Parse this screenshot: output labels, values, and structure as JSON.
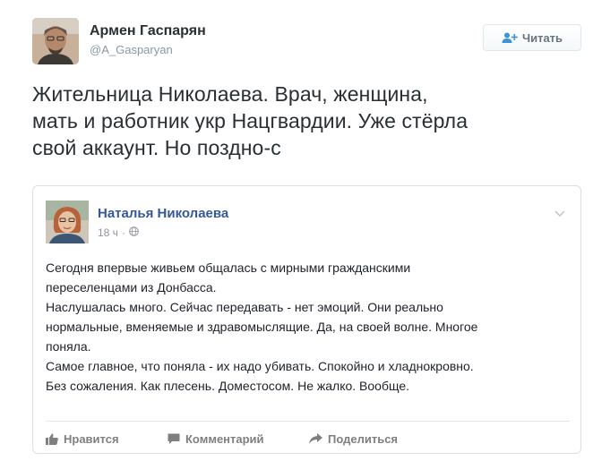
{
  "tweet": {
    "author": {
      "name": "Армен Гаспарян",
      "handle": "@A_Gasparyan"
    },
    "follow_button": {
      "label": "Читать",
      "icon": "add-user-icon"
    },
    "text_lines": [
      "Жительница Николаева. Врач, женщина,",
      "мать и работник укр Нацгвардии. Уже стёрла",
      "свой аккаунт. Но поздно-с"
    ]
  },
  "embedded_post": {
    "author_name": "Наталья Николаева",
    "time": "18 ч",
    "separator": "·",
    "privacy_icon": "globe-icon",
    "menu_icon": "chevron-down-icon",
    "text_lines": [
      "Сегодня впервые живьем общалась с мирными гражданскими",
      "переселенцами из Донбасса.",
      "Наслушалась много. Сейчас передавать - нет эмоций. Они реально",
      "нормальные, вменяемые и здравомыслящие. Да, на своей волне. Многое",
      "поняла.",
      "Самое главное, что поняла - их надо убивать. Спокойно и хладнокровно.",
      "Без сожаления. Как плесень. Доместосом. Не жалко. Вообще."
    ],
    "actions": {
      "like": "Нравится",
      "comment": "Комментарий",
      "share": "Поделиться"
    }
  },
  "colors": {
    "tweet_text": "#292f33",
    "handle": "#8899a6",
    "follow_icon": "#3b94d9",
    "facebook_name": "#365899",
    "facebook_meta": "#90949c",
    "facebook_action": "#7f7f7f",
    "embed_border": "#dddfe2"
  }
}
